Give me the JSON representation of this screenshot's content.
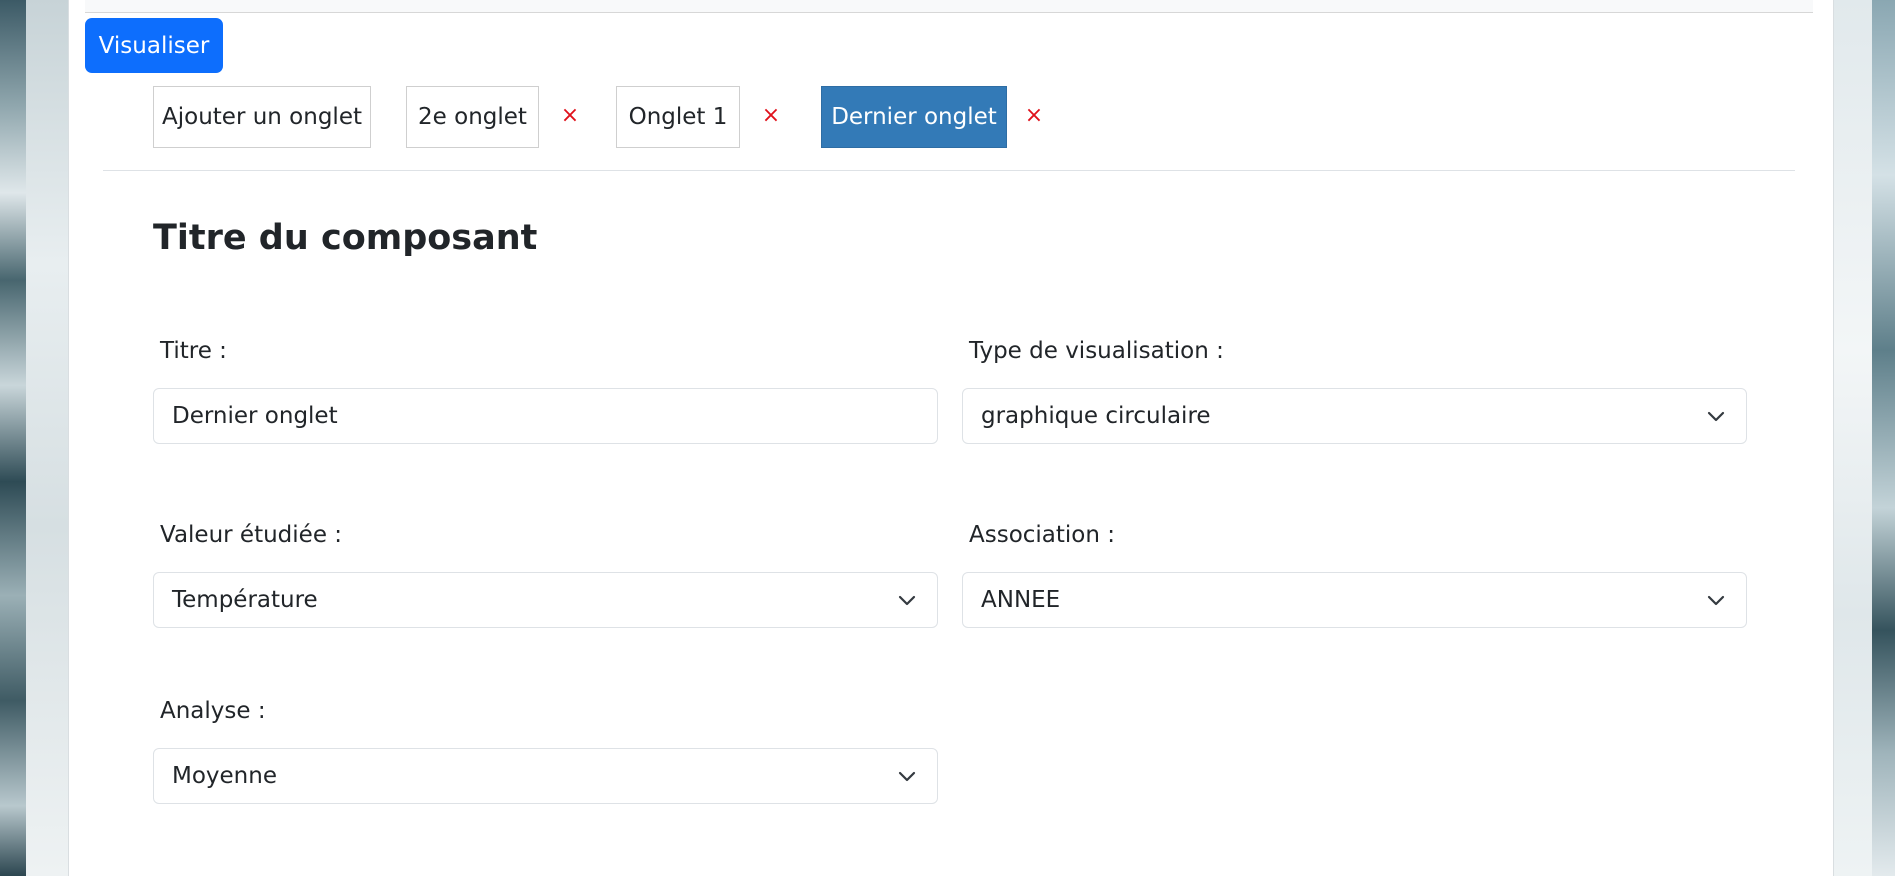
{
  "toolbar": {
    "visualiser_label": "Visualiser"
  },
  "tabs": {
    "add_label": "Ajouter un onglet",
    "items": [
      {
        "label": "2e onglet",
        "close": "×"
      },
      {
        "label": "Onglet 1",
        "close": "×"
      },
      {
        "label": "Dernier onglet",
        "close": "×",
        "active": true
      }
    ]
  },
  "component": {
    "title": "Titre du composant",
    "fields": {
      "titre": {
        "label": "Titre :",
        "value": "Dernier onglet"
      },
      "type_visualisation": {
        "label": "Type de visualisation :",
        "value": "graphique circulaire"
      },
      "valeur_etudiee": {
        "label": "Valeur étudiée :",
        "value": "Température"
      },
      "association": {
        "label": "Association :",
        "value": "ANNEE"
      },
      "analyse": {
        "label": "Analyse :",
        "value": "Moyenne"
      }
    }
  },
  "colors": {
    "primary": "#0d6efd",
    "active_tab": "#337ab7",
    "close": "#e0111b"
  }
}
